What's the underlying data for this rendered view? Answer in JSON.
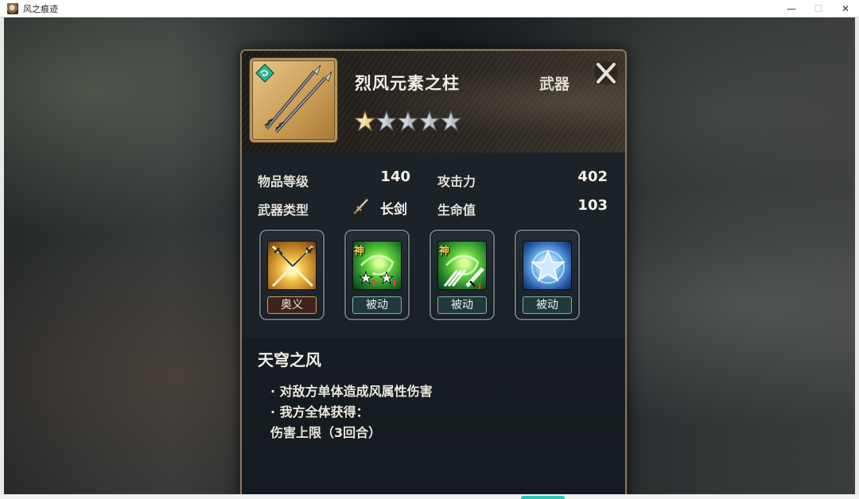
{
  "window": {
    "title": "风之痕迹",
    "minimize": "—",
    "maximize": "☐",
    "close": "✕"
  },
  "item": {
    "name": "烈风元素之柱",
    "category": "武器",
    "stars": 5,
    "filled_stars": 1,
    "close_glyph": "X"
  },
  "stats": {
    "level_label": "物品等级",
    "level_value": "140",
    "attack_label": "攻击力",
    "attack_value": "402",
    "type_label": "武器类型",
    "type_value": "长剑",
    "hp_label": "生命值",
    "hp_value": "103"
  },
  "skills": [
    {
      "tag": "奥义",
      "god": "",
      "icon": "crossed-swords-icon"
    },
    {
      "tag": "被动",
      "god": "神",
      "icon": "wind-spark-icon"
    },
    {
      "tag": "被动",
      "god": "神",
      "icon": "wind-blade-icon"
    },
    {
      "tag": "被动",
      "god": "",
      "icon": "ice-star-icon"
    }
  ],
  "description": {
    "title": "天穹之风",
    "lines": [
      "· 对敌方单体造成风属性伤害",
      "· 我方全体获得：",
      "伤害上限（3回合）"
    ]
  },
  "colors": {
    "panel_border": "#8b7a5c",
    "tag_passive_border": "#7fb3ac",
    "tag_ult_border": "#d0a060",
    "god_mark": "#ffd24a"
  }
}
